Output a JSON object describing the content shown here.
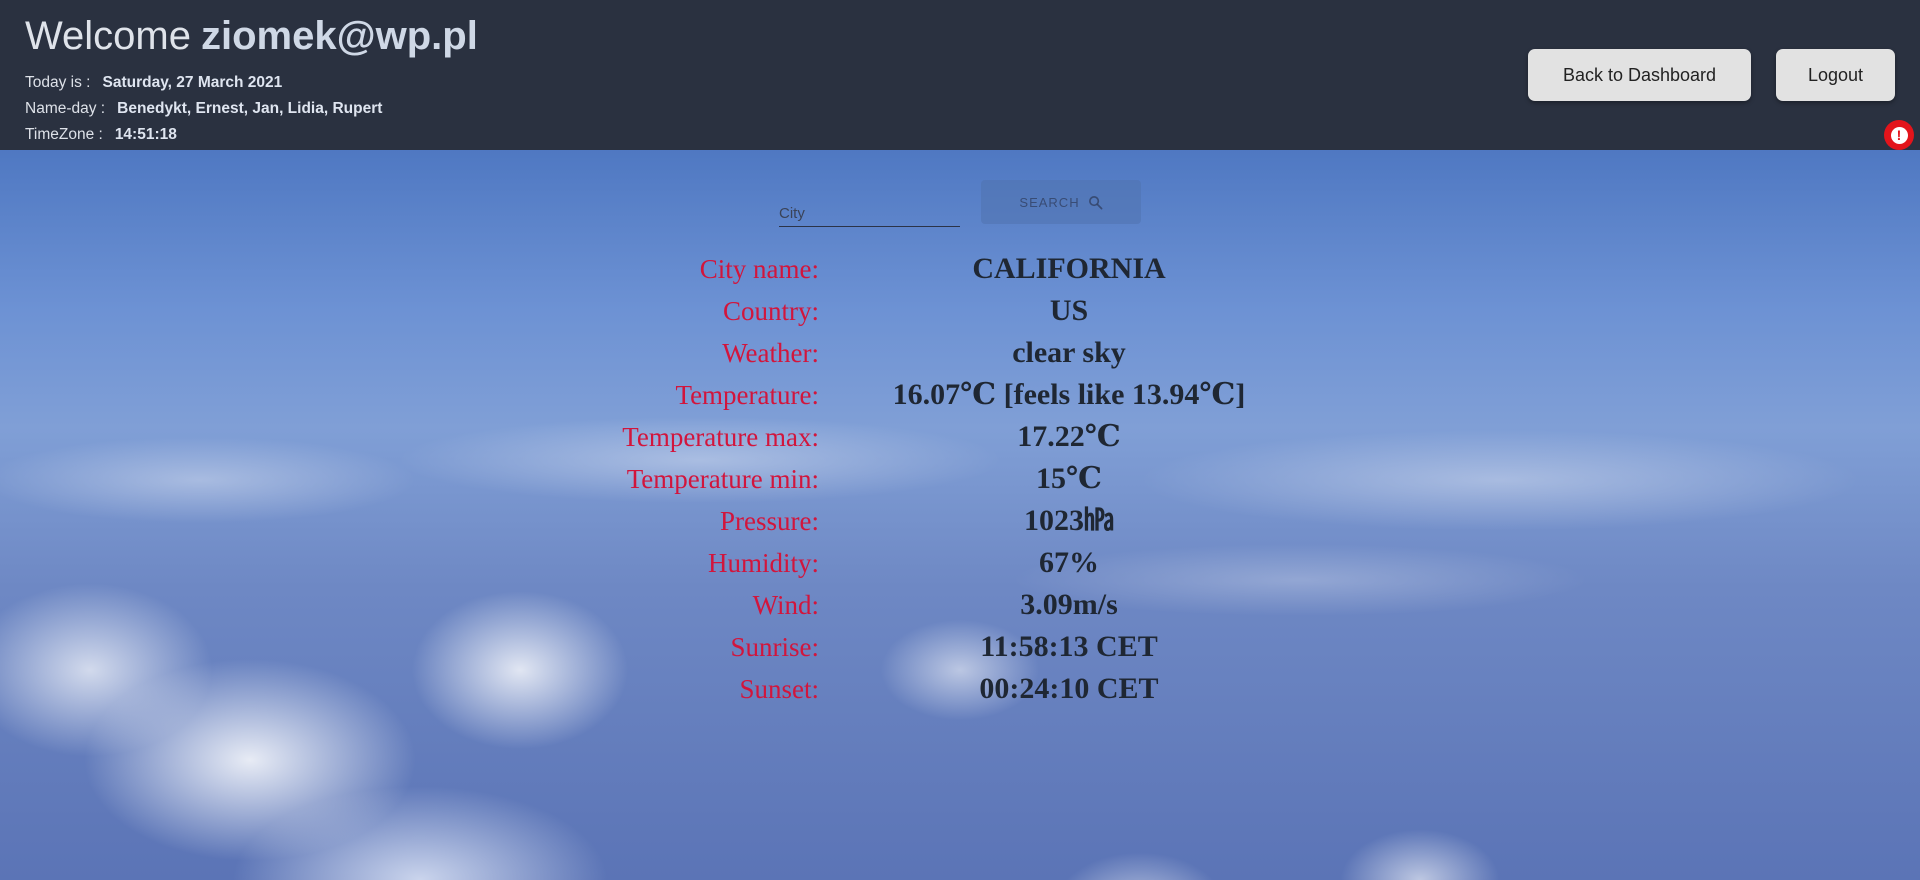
{
  "header": {
    "welcome_text": "Welcome",
    "user_email": "ziomek@wp.pl",
    "today_label": "Today is :",
    "today_value": "Saturday, 27 March 2021",
    "nameday_label": "Name-day :",
    "nameday_value": "Benedykt, Ernest, Jan, Lidia, Rupert",
    "timezone_label": "TimeZone :",
    "timezone_value": "14:51:18",
    "dashboard_button": "Back to Dashboard",
    "logout_button": "Logout",
    "alert_icon": "exclamation-circle-icon",
    "alert_glyph": "!"
  },
  "search": {
    "city_placeholder": "City",
    "city_value": "",
    "button_label": "SEARCH",
    "button_icon": "search-icon"
  },
  "weather": {
    "city_name_label": "City name:",
    "city_name_value": "CALIFORNIA",
    "country_label": "Country:",
    "country_value": "US",
    "weather_label": "Weather:",
    "weather_value": "clear sky",
    "temperature_label": "Temperature:",
    "temperature_value": "16.07℃ [feels like 13.94℃]",
    "temp_max_label": "Temperature max:",
    "temp_max_value": "17.22℃",
    "temp_min_label": "Temperature min:",
    "temp_min_value": "15℃",
    "pressure_label": "Pressure:",
    "pressure_value": "1023㍱",
    "humidity_label": "Humidity:",
    "humidity_value": "67%",
    "wind_label": "Wind:",
    "wind_value": "3.09m/s",
    "sunrise_label": "Sunrise:",
    "sunrise_value": "11:58:13 CET",
    "sunset_label": "Sunset:",
    "sunset_value": "00:24:10 CET"
  },
  "colors": {
    "header_bg": "#2a3140",
    "label_color": "#d2153c",
    "value_color": "#1f2733",
    "alert_color": "#e3141b"
  }
}
